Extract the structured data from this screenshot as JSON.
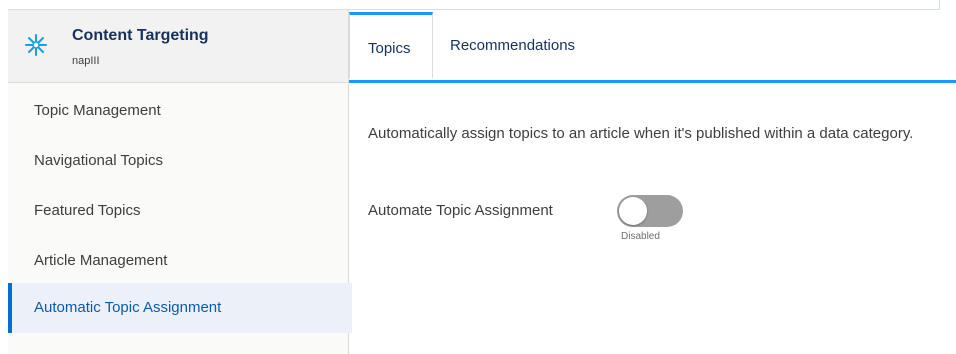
{
  "app": {
    "title": "Content Targeting",
    "subtitle": "napIII",
    "icon": "sparkle-icon",
    "icon_color": "#16a0e0"
  },
  "sidebar": {
    "items": [
      {
        "label": "Topic Management",
        "active": false
      },
      {
        "label": "Navigational Topics",
        "active": false
      },
      {
        "label": "Featured Topics",
        "active": false
      },
      {
        "label": "Article Management",
        "active": false
      },
      {
        "label": "Automatic Topic Assignment",
        "active": true
      }
    ]
  },
  "tabs": [
    {
      "label": "Topics",
      "active": true
    },
    {
      "label": "Recommendations",
      "active": false
    }
  ],
  "content": {
    "description": "Automatically assign topics to an article when it's published within a data category.",
    "toggle_label": "Automate Topic Assignment",
    "toggle_state": "Disabled",
    "toggle_on": false
  },
  "colors": {
    "accent": "#1b96ff",
    "active_text": "#0b5cab",
    "toggle_off": "#9e9e9e"
  }
}
